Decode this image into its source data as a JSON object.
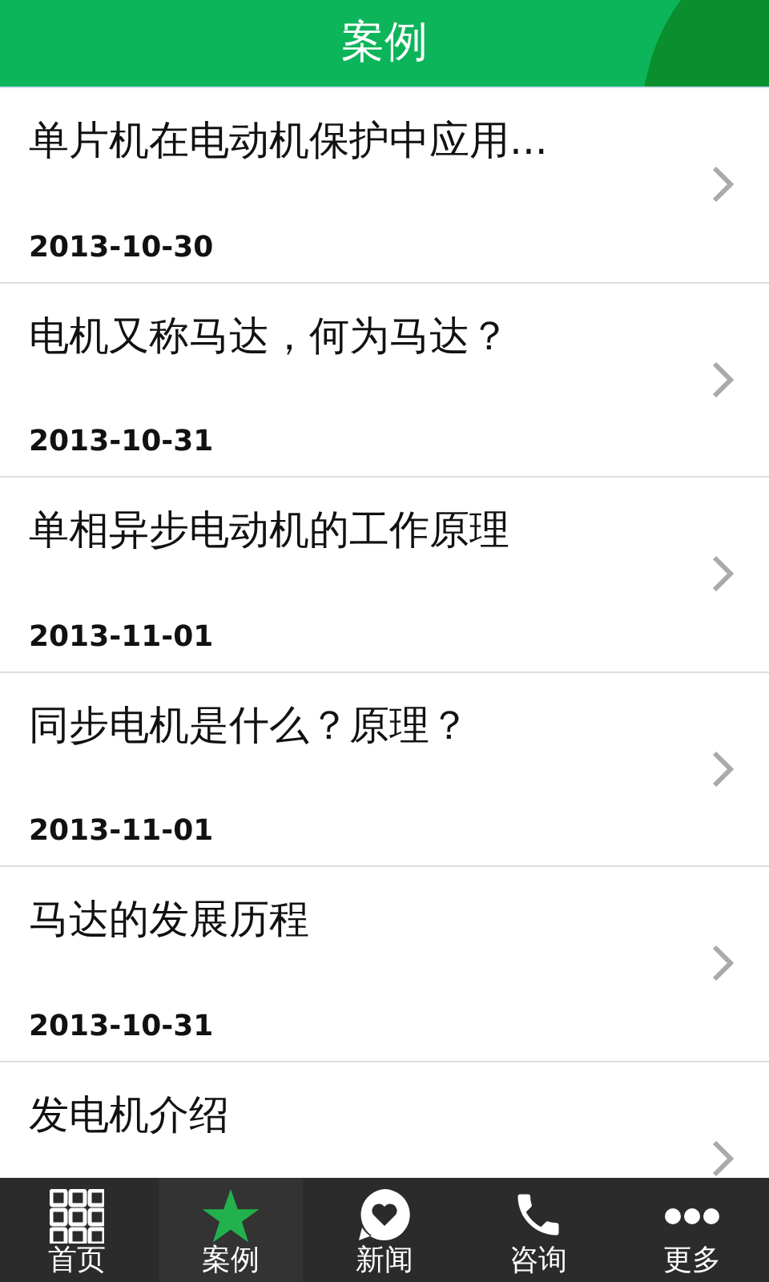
{
  "header": {
    "title": "案例"
  },
  "articles": [
    {
      "title": "单片机在电动机保护中应用...",
      "date": "2013-10-30"
    },
    {
      "title": "电机又称马达，何为马达？",
      "date": "2013-10-31"
    },
    {
      "title": "单相异步电动机的工作原理",
      "date": "2013-11-01"
    },
    {
      "title": "同步电机是什么？原理？",
      "date": "2013-11-01"
    },
    {
      "title": "马达的发展历程",
      "date": "2013-10-31"
    },
    {
      "title": "发电机介绍"
    }
  ],
  "nav": [
    {
      "label": "首页",
      "kind": "grid",
      "selected": false
    },
    {
      "label": "案例",
      "kind": "star",
      "selected": true
    },
    {
      "label": "新闻",
      "kind": "heart",
      "selected": false
    },
    {
      "label": "咨询",
      "kind": "phone",
      "selected": false
    },
    {
      "label": "更多",
      "kind": "dots",
      "selected": false
    }
  ]
}
